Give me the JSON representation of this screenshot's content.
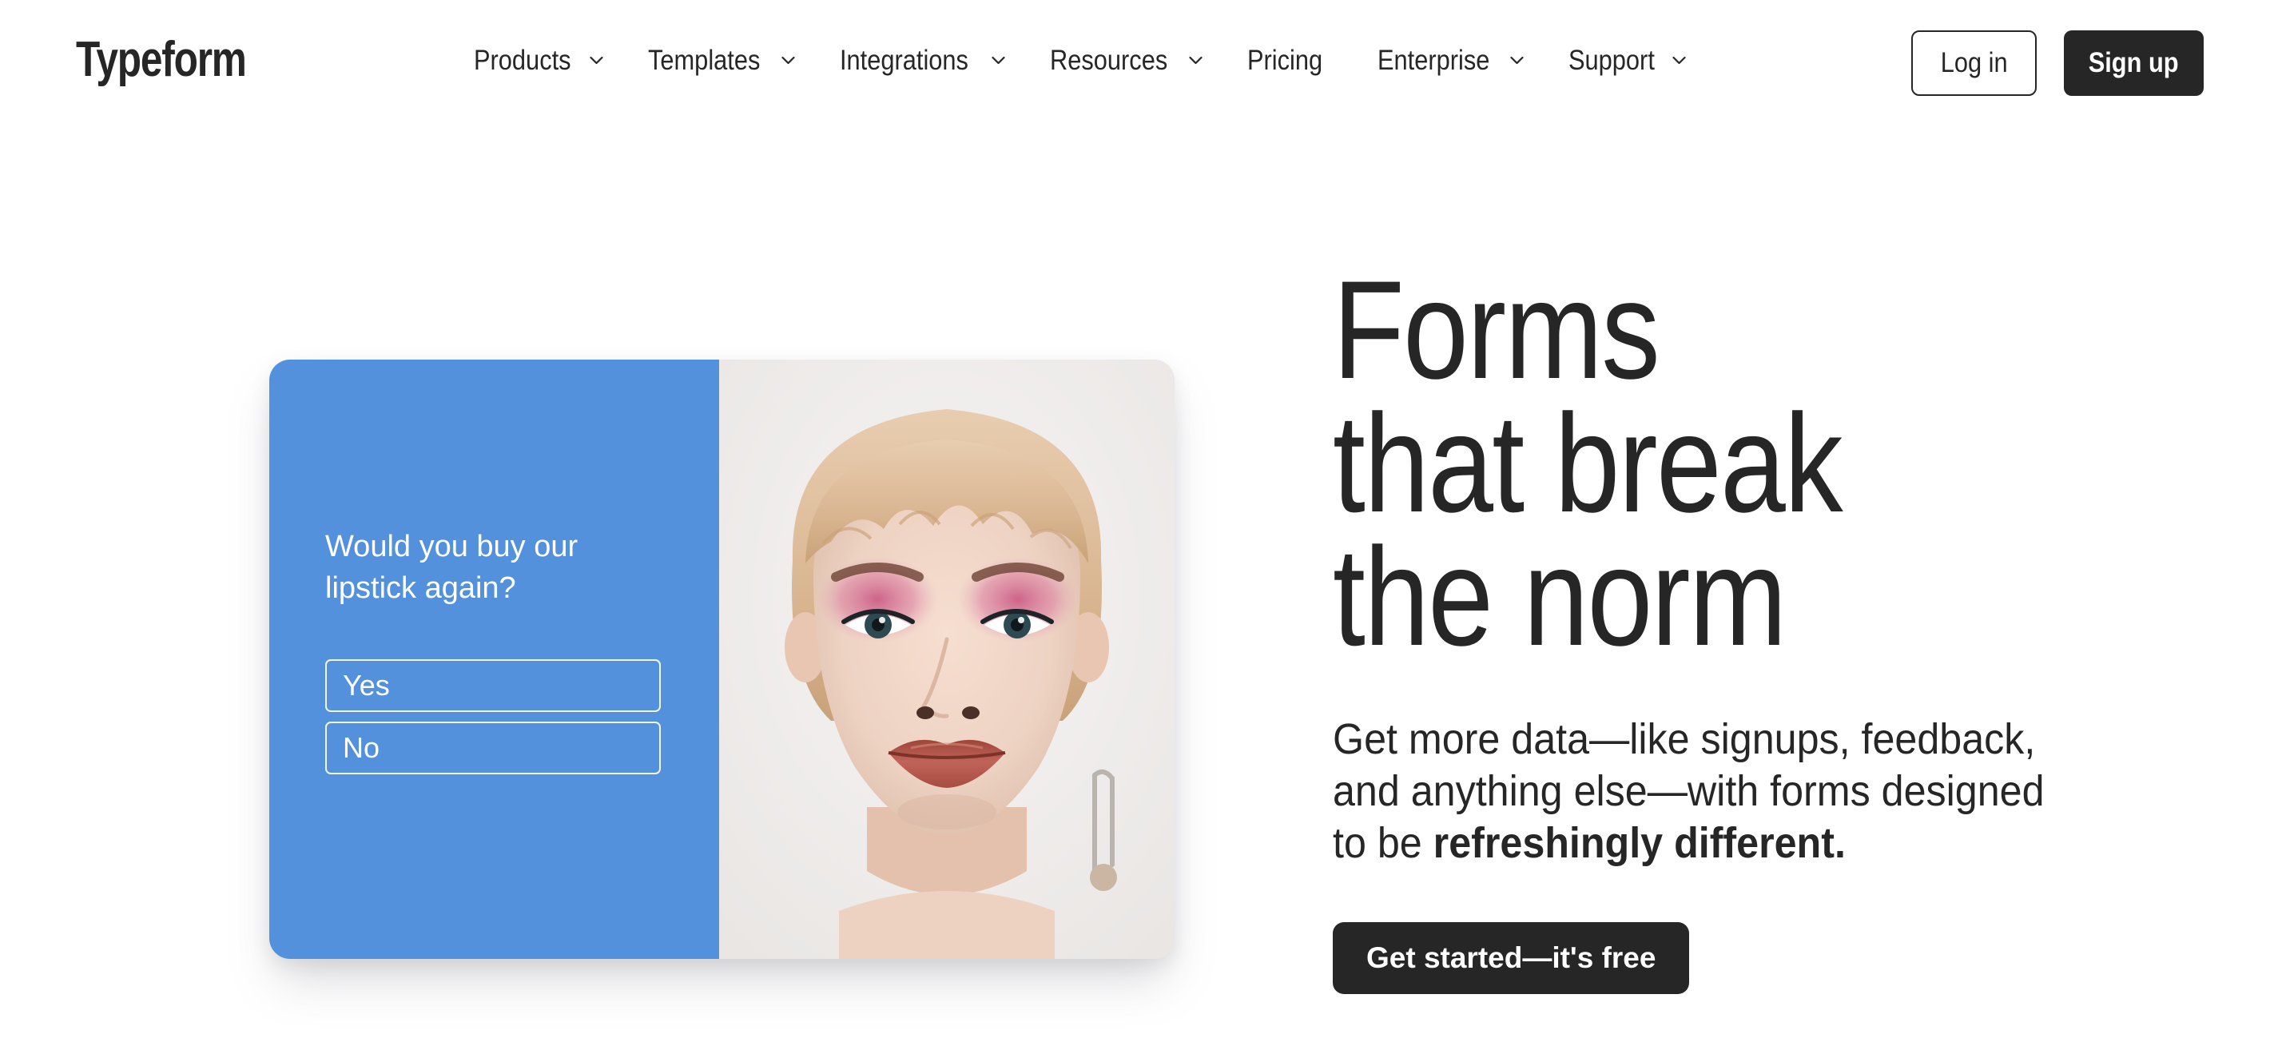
{
  "navbar": {
    "logo": "Typeform",
    "items": [
      {
        "label": "Products",
        "has_chevron": true,
        "icon": "chevron-down-icon"
      },
      {
        "label": "Templates",
        "has_chevron": true,
        "icon": "chevron-down-icon"
      },
      {
        "label": "Integrations",
        "has_chevron": true,
        "icon": "chevron-down-icon"
      },
      {
        "label": "Resources",
        "has_chevron": true,
        "icon": "chevron-down-icon"
      },
      {
        "label": "Pricing",
        "has_chevron": false,
        "icon": ""
      },
      {
        "label": "Enterprise",
        "has_chevron": true,
        "icon": "chevron-down-icon"
      },
      {
        "label": "Support",
        "has_chevron": true,
        "icon": "chevron-down-icon"
      }
    ],
    "login_label": "Log in",
    "signup_label": "Sign up"
  },
  "hero": {
    "headline_line1": "Forms",
    "headline_line2": "that break",
    "headline_line3": "the norm",
    "subhead_normal": "Get more data—like signups, feedback, and anything else—with forms designed to be ",
    "subhead_bold": "refreshingly different.",
    "cta_label": "Get started—it's free"
  },
  "form_card": {
    "question": "Would you buy our lipstick again?",
    "options": [
      {
        "label": "Yes"
      },
      {
        "label": "No"
      }
    ],
    "accent_color": "#5491DC",
    "photo_alt": "portrait-photo"
  },
  "colors": {
    "page_background": "#ffffff",
    "text_dark": "#262627",
    "card_blue": "#5491DC",
    "button_dark": "#262627"
  }
}
